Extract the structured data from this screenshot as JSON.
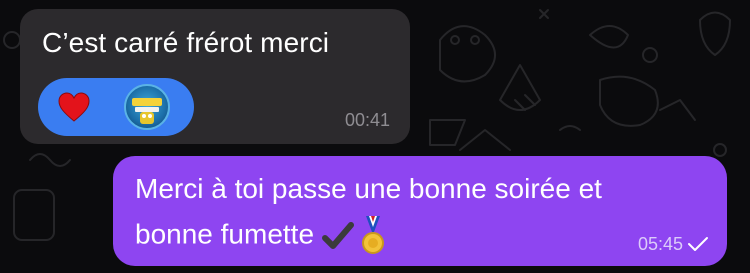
{
  "incoming_message": {
    "text": "C’est carré frérot merci",
    "time": "00:41",
    "reactions": [
      {
        "icon": "red-heart-icon"
      },
      {
        "icon": "sticker-avatar-icon"
      }
    ]
  },
  "outgoing_message": {
    "line1": "Merci à toi passe une bonne soirée et",
    "line2": "bonne fumette",
    "emojis": [
      "heavy-check-mark-icon",
      "medal-icon"
    ],
    "time": "05:45",
    "status_icon": "single-check-icon"
  },
  "colors": {
    "background": "#0b0b0d",
    "incoming_bubble": "#2c2a2d",
    "outgoing_bubble": "#8e45f1",
    "reaction_pill": "#3a7df1",
    "heart": "#e3131b"
  }
}
